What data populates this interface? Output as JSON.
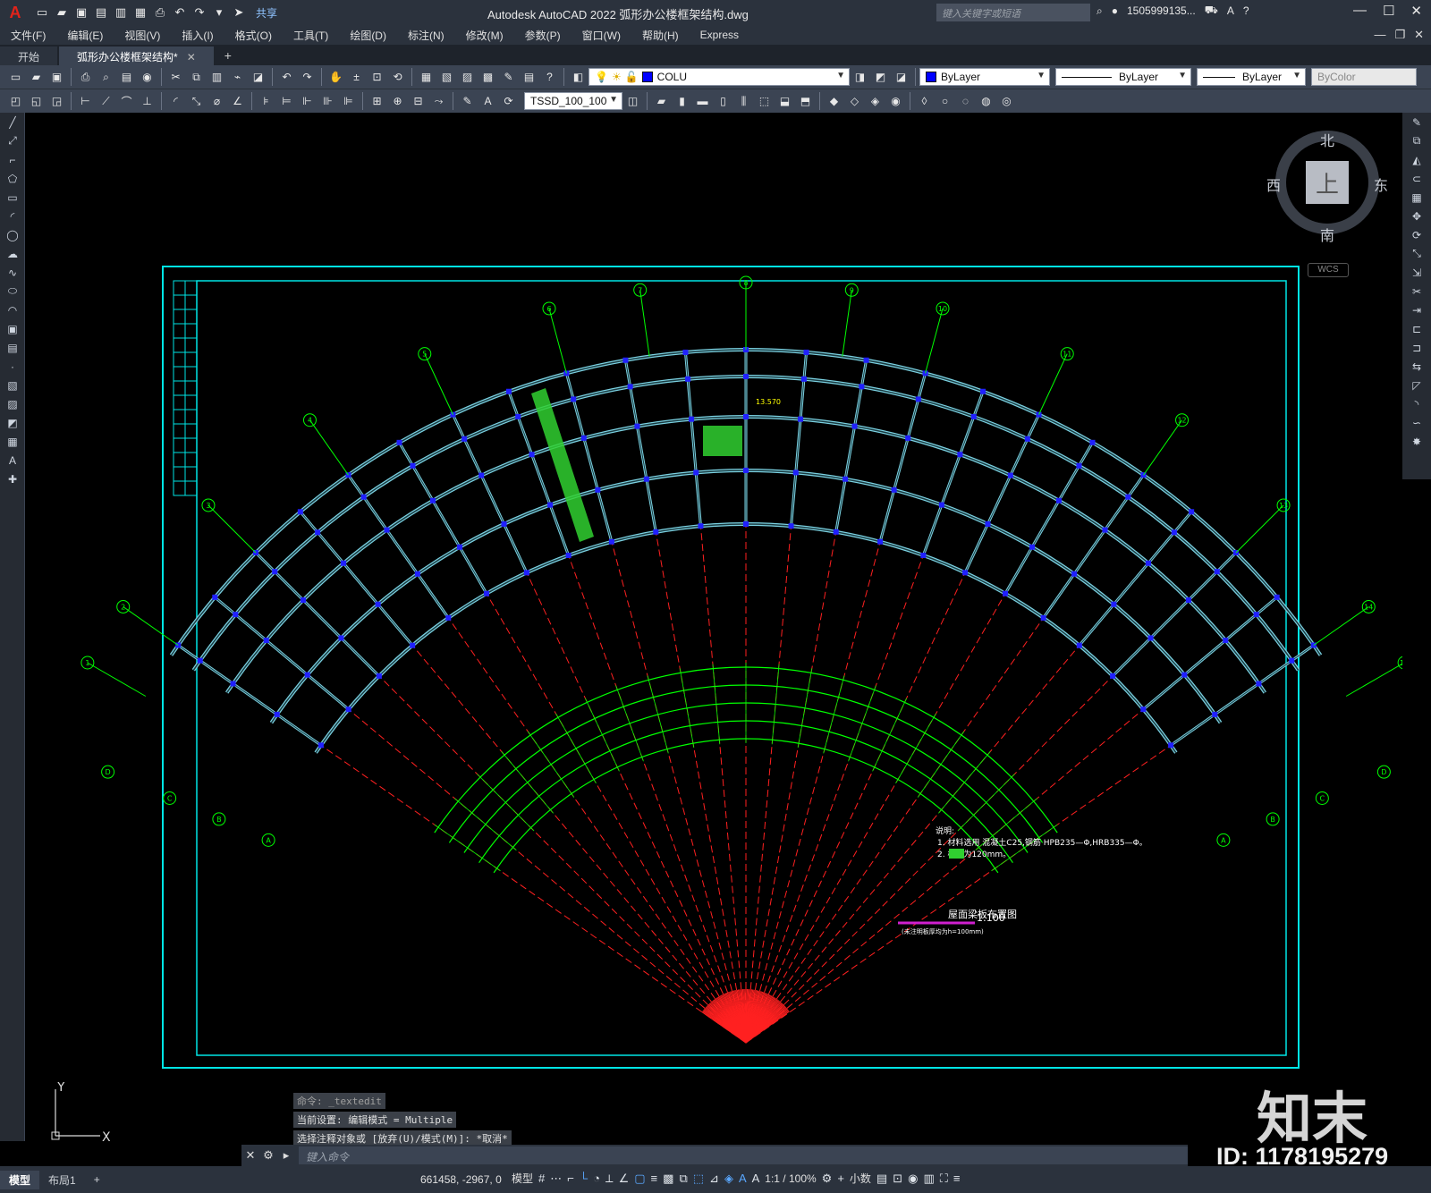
{
  "titlebar": {
    "logo": "A",
    "share": "共享",
    "app_title": "Autodesk AutoCAD 2022    弧形办公楼框架结构.dwg",
    "search_placeholder": "键入关键字或短语",
    "user": "1505999135...",
    "help": "?"
  },
  "menu": [
    "文件(F)",
    "编辑(E)",
    "视图(V)",
    "插入(I)",
    "格式(O)",
    "工具(T)",
    "绘图(D)",
    "标注(N)",
    "修改(M)",
    "参数(P)",
    "窗口(W)",
    "帮助(H)",
    "Express"
  ],
  "tabs": {
    "start": "开始",
    "file": "弧形办公楼框架结构*",
    "add": "+"
  },
  "toolbar": {
    "layer": "COLU",
    "color": "ByLayer",
    "linetype": "ByLayer",
    "lineweight": "ByLayer",
    "plotstyle": "ByColor",
    "dimstyle": "TSSD_100_100",
    "layer_color": "#0000ff"
  },
  "viewcube": {
    "north": "北",
    "south": "南",
    "east": "东",
    "west": "西",
    "top": "上",
    "wcs": "WCS"
  },
  "ucs": {
    "y": "Y",
    "x": "X"
  },
  "drawing": {
    "title": "屋面梁板布置图",
    "scale": "1:100",
    "subtitle": "(未注明板厚均为h=100mm)",
    "notes_title": "说明:",
    "note1": "1. 材料选用 混凝土C25,钢筋 HPB235—Φ,HRB335—Φ。",
    "note2": "2.          板厚为120mm。",
    "axis_labels": [
      "1",
      "2",
      "3",
      "4",
      "5",
      "6",
      "7",
      "8",
      "9",
      "10",
      "11",
      "12",
      "13",
      "14",
      "15"
    ],
    "row_labels": [
      "A",
      "B",
      "C",
      "D"
    ],
    "elevation": "13.570"
  },
  "command": {
    "history": [
      "命令: _textedit",
      "当前设置: 编辑模式 = Multiple",
      "选择注释对象或 [放弃(U)/模式(M)]: *取消*"
    ],
    "placeholder": "键入命令"
  },
  "status": {
    "model_tab": "模型",
    "layout_tab": "布局1",
    "coords": "661458, -2967, 0",
    "model_space": "模型",
    "scale": "1:1 / 100%",
    "units": "小数"
  },
  "brand": {
    "logo": "知末",
    "id": "ID: 1178195279"
  },
  "colors": {
    "frame": "#00e5e5",
    "grid_axis": "#ff2020",
    "dimension": "#00ff00",
    "beam": "#7ad0e0",
    "column": "#2020ff",
    "slab_hatch": "#30d030"
  }
}
